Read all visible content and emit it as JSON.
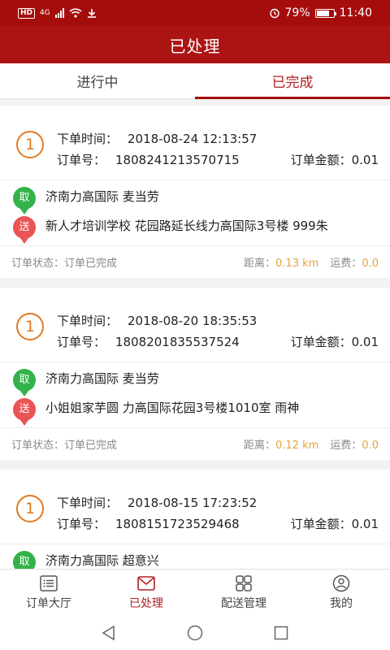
{
  "status": {
    "hd": "HD",
    "network": "4G",
    "battery": "79%",
    "time": "11:40",
    "battery_level": 0.79
  },
  "header": {
    "title": "已处理"
  },
  "tabs": [
    {
      "label": "进行中"
    },
    {
      "label": "已完成"
    }
  ],
  "labels": {
    "order_time": "下单时间：",
    "order_no": "订单号：",
    "order_amount": "订单金额：",
    "status_prefix": "订单状态：",
    "distance": "距离：",
    "fee": "运费：",
    "pickup_badge": "取",
    "drop_badge": "送"
  },
  "orders": [
    {
      "index": "1",
      "time": "2018-08-24 12:13:57",
      "number": "1808241213570715",
      "amount": "0.01",
      "pickup": "济南力高国际 麦当劳",
      "delivery": "新人才培训学校 花园路延长线力高国际3号楼 999朱",
      "status": "订单已完成",
      "distance": "0.13 km",
      "fee": "0.0"
    },
    {
      "index": "1",
      "time": "2018-08-20 18:35:53",
      "number": "1808201835537524",
      "amount": "0.01",
      "pickup": "济南力高国际 麦当劳",
      "delivery": "小姐姐家芋圆 力高国际花园3号楼1010室 雨神",
      "status": "订单已完成",
      "distance": "0.12 km",
      "fee": "0.0"
    },
    {
      "index": "1",
      "time": "2018-08-15 17:23:52",
      "number": "1808151723529468",
      "amount": "0.01",
      "pickup": "济南力高国际 超意兴"
    }
  ],
  "tabbar": [
    {
      "label": "订单大厅",
      "icon": "list-icon"
    },
    {
      "label": "已处理",
      "icon": "mail-icon"
    },
    {
      "label": "配送管理",
      "icon": "grid-icon"
    },
    {
      "label": "我的",
      "icon": "user-icon"
    }
  ],
  "colors": {
    "brand": "#a50c0c",
    "accent_orange": "#e07a22",
    "pickup": "#33b24a",
    "delivery": "#e95455",
    "value": "#e5a33a"
  }
}
